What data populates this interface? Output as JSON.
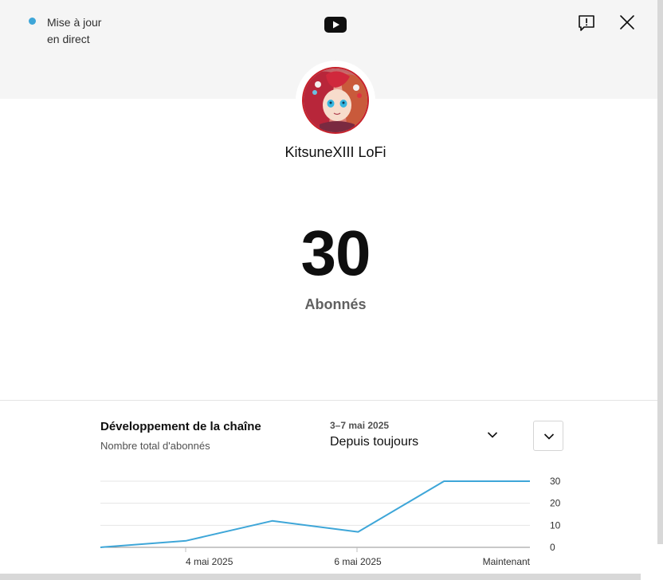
{
  "live_status": {
    "line1": "Mise à jour",
    "line2": "en direct",
    "dot_color": "#3ea6d8"
  },
  "header": {
    "logo_icon": "youtube-icon",
    "report_icon": "report-icon",
    "close_icon": "close-icon"
  },
  "channel": {
    "name": "KitsuneXIII LoFi",
    "avatar_alt": "channel-avatar"
  },
  "subscribers": {
    "count": "30",
    "label": "Abonnés"
  },
  "growth": {
    "title": "Développement de la chaîne",
    "subtitle": "Nombre total d'abonnés",
    "period_range": "3–7 mai 2025",
    "period_value": "Depuis toujours"
  },
  "chart_data": {
    "type": "line",
    "line_color": "#3ea6d8",
    "x_tick_labels": [
      "4 mai 2025",
      "6 mai 2025",
      "Maintenant"
    ],
    "y_ticks": [
      0,
      10,
      20,
      30
    ],
    "ylim": [
      0,
      30
    ],
    "grid": true,
    "y_axis_side": "right",
    "values": [
      0,
      3,
      12,
      7,
      30,
      30
    ]
  }
}
